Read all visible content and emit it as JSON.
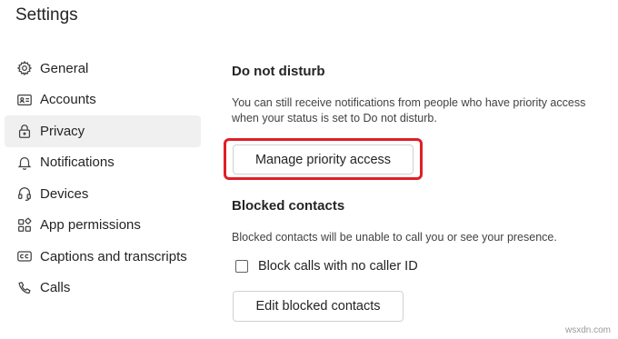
{
  "page": {
    "title": "Settings"
  },
  "sidebar": {
    "items": [
      {
        "label": "General",
        "icon": "gear-icon",
        "active": false
      },
      {
        "label": "Accounts",
        "icon": "id-card-icon",
        "active": false
      },
      {
        "label": "Privacy",
        "icon": "lock-icon",
        "active": true
      },
      {
        "label": "Notifications",
        "icon": "bell-icon",
        "active": false
      },
      {
        "label": "Devices",
        "icon": "headset-icon",
        "active": false
      },
      {
        "label": "App permissions",
        "icon": "apps-icon",
        "active": false
      },
      {
        "label": "Captions and transcripts",
        "icon": "cc-icon",
        "active": false
      },
      {
        "label": "Calls",
        "icon": "phone-icon",
        "active": false
      }
    ]
  },
  "dnd": {
    "heading": "Do not disturb",
    "description_line1": "You can still receive notifications from people who have priority access",
    "description_line2": "when your status is set to Do not disturb.",
    "manage_button": "Manage priority access"
  },
  "blocked": {
    "heading": "Blocked contacts",
    "description": "Blocked contacts will be unable to call you or see your presence.",
    "checkbox_label": "Block calls with no caller ID",
    "checkbox_checked": false,
    "edit_button": "Edit blocked contacts"
  },
  "colors": {
    "highlight": "#e01f26",
    "active_bg": "#f0f0f0"
  },
  "watermark": "wsxdn.com"
}
